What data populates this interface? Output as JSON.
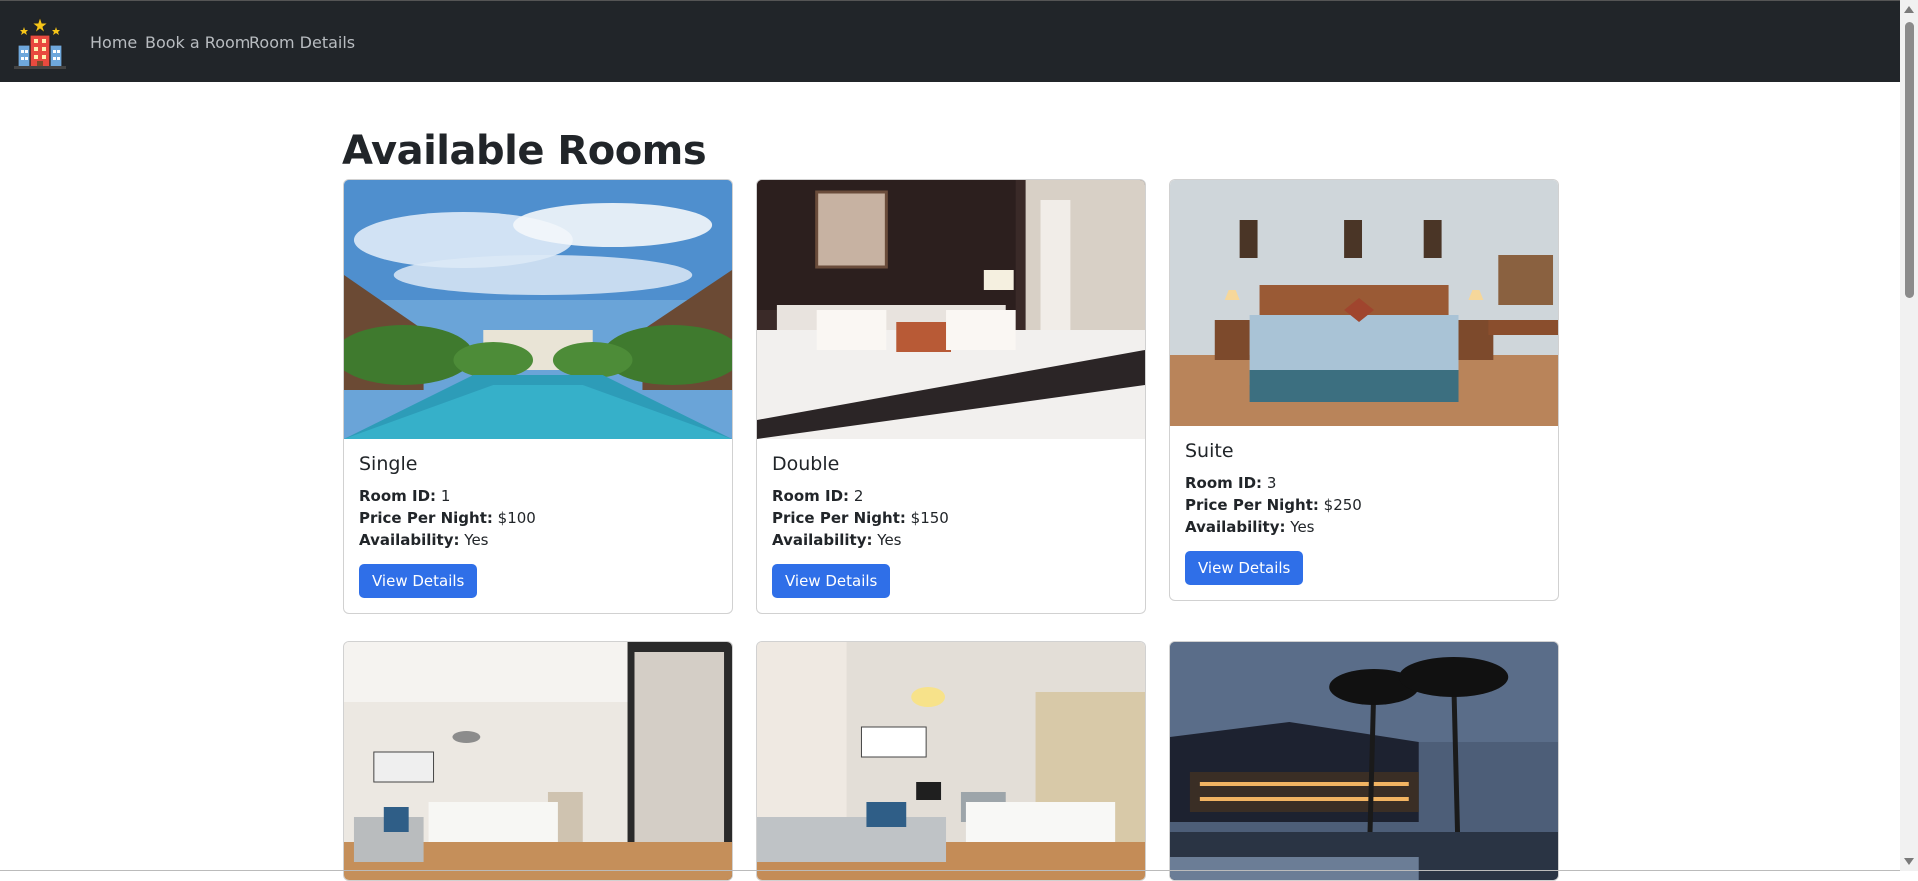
{
  "nav": {
    "logo_icon": "hotel-building-icon",
    "links": [
      "Home",
      "Book a Room",
      "Room Details"
    ]
  },
  "page": {
    "title": "Available Rooms"
  },
  "labels": {
    "room_id": "Room ID:",
    "price": "Price Per Night:",
    "availability": "Availability:",
    "button": "View Details"
  },
  "rooms": [
    {
      "type": "Single",
      "id": "1",
      "price": "$100",
      "availability": "Yes",
      "image": "resort-pool-photo"
    },
    {
      "type": "Double",
      "id": "2",
      "price": "$150",
      "availability": "Yes",
      "image": "hotel-bedroom-photo"
    },
    {
      "type": "Suite",
      "id": "3",
      "price": "$250",
      "availability": "Yes",
      "image": "suite-bedroom-photo"
    },
    {
      "image": "hotel-room-twin-beds-photo"
    },
    {
      "image": "hotel-room-desk-photo"
    },
    {
      "image": "resort-night-palms-photo"
    }
  ],
  "colors": {
    "navbar": "#212529",
    "button": "#2f6fe8"
  }
}
